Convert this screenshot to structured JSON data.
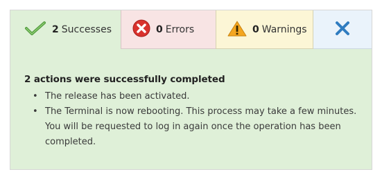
{
  "tabs": {
    "successes": {
      "count": "2",
      "label": "Successes",
      "icon": "checkmark-icon"
    },
    "errors": {
      "count": "0",
      "label": "Errors",
      "icon": "error-icon"
    },
    "warnings": {
      "count": "0",
      "label": "Warnings",
      "icon": "warning-icon"
    },
    "close": {
      "icon": "close-icon"
    }
  },
  "message": {
    "heading": "2 actions were successfully completed",
    "items": [
      "The release has been activated.",
      "The Terminal is now rebooting. This process may take a few minutes. You will be requested to log in again once the operation has been completed."
    ]
  },
  "colors": {
    "success_bg": "#dff0d8",
    "error_bg": "#f8e4e4",
    "warning_bg": "#fcf6d6",
    "close_bg": "#eaf3fb",
    "close_x": "#2f7cc0"
  }
}
